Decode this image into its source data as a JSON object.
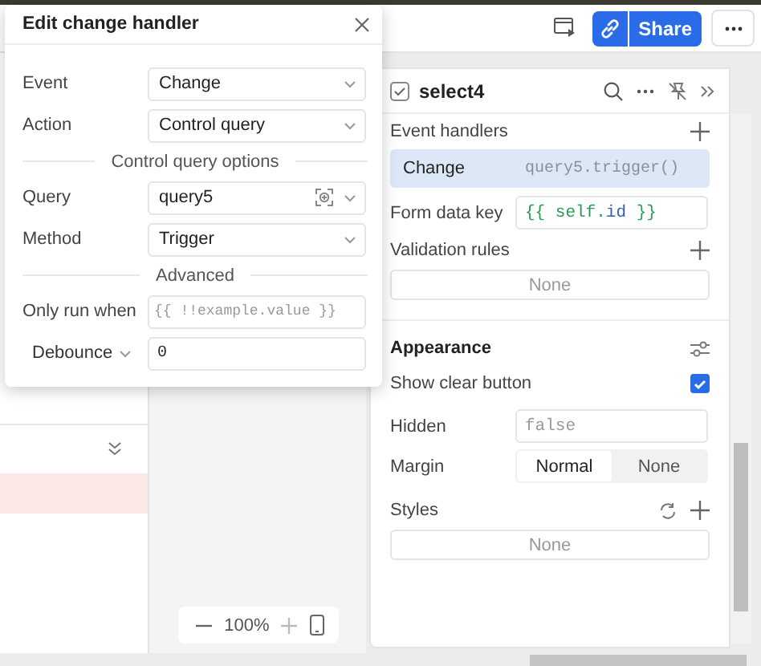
{
  "topbar": {
    "share_label": "Share"
  },
  "dialog": {
    "title": "Edit change handler",
    "rows": [
      {
        "kind": "select",
        "label": "Event",
        "value": "Change"
      },
      {
        "kind": "select",
        "label": "Action",
        "value": "Control query"
      },
      {
        "kind": "heading",
        "label": "Control query options"
      },
      {
        "kind": "select",
        "label": "Query",
        "value": "query5",
        "picker": true
      },
      {
        "kind": "select",
        "label": "Method",
        "value": "Trigger"
      },
      {
        "kind": "heading",
        "label": "Advanced"
      },
      {
        "kind": "input",
        "label": "Only run when",
        "placeholder": "{{ !!example.value }}"
      },
      {
        "kind": "dropdown_input",
        "label": "Debounce",
        "value": "0"
      }
    ]
  },
  "canvas": {
    "zoom": "100%"
  },
  "inspector": {
    "title": "select4",
    "items": [
      {
        "kind": "section",
        "label": "Event handlers",
        "add": true
      },
      {
        "kind": "handler",
        "event": "Change",
        "action": "query5.trigger()"
      },
      {
        "kind": "input",
        "label": "Form data key",
        "value": "{{ self.id }}",
        "code": true
      },
      {
        "kind": "section",
        "label": "Validation rules",
        "add": true
      },
      {
        "kind": "empty",
        "label": "None"
      },
      {
        "kind": "divider"
      },
      {
        "kind": "title",
        "label": "Appearance",
        "settings": true
      },
      {
        "kind": "checkbox",
        "label": "Show clear button",
        "checked": true
      },
      {
        "kind": "input",
        "label": "Hidden",
        "placeholder": "false"
      },
      {
        "kind": "segmented",
        "label": "Margin",
        "options": [
          {
            "label": "Normal",
            "selected": true
          },
          {
            "label": "None",
            "selected": false
          }
        ]
      },
      {
        "kind": "section",
        "label": "Styles",
        "add": true,
        "reset": true
      },
      {
        "kind": "empty",
        "label": "None"
      }
    ]
  }
}
